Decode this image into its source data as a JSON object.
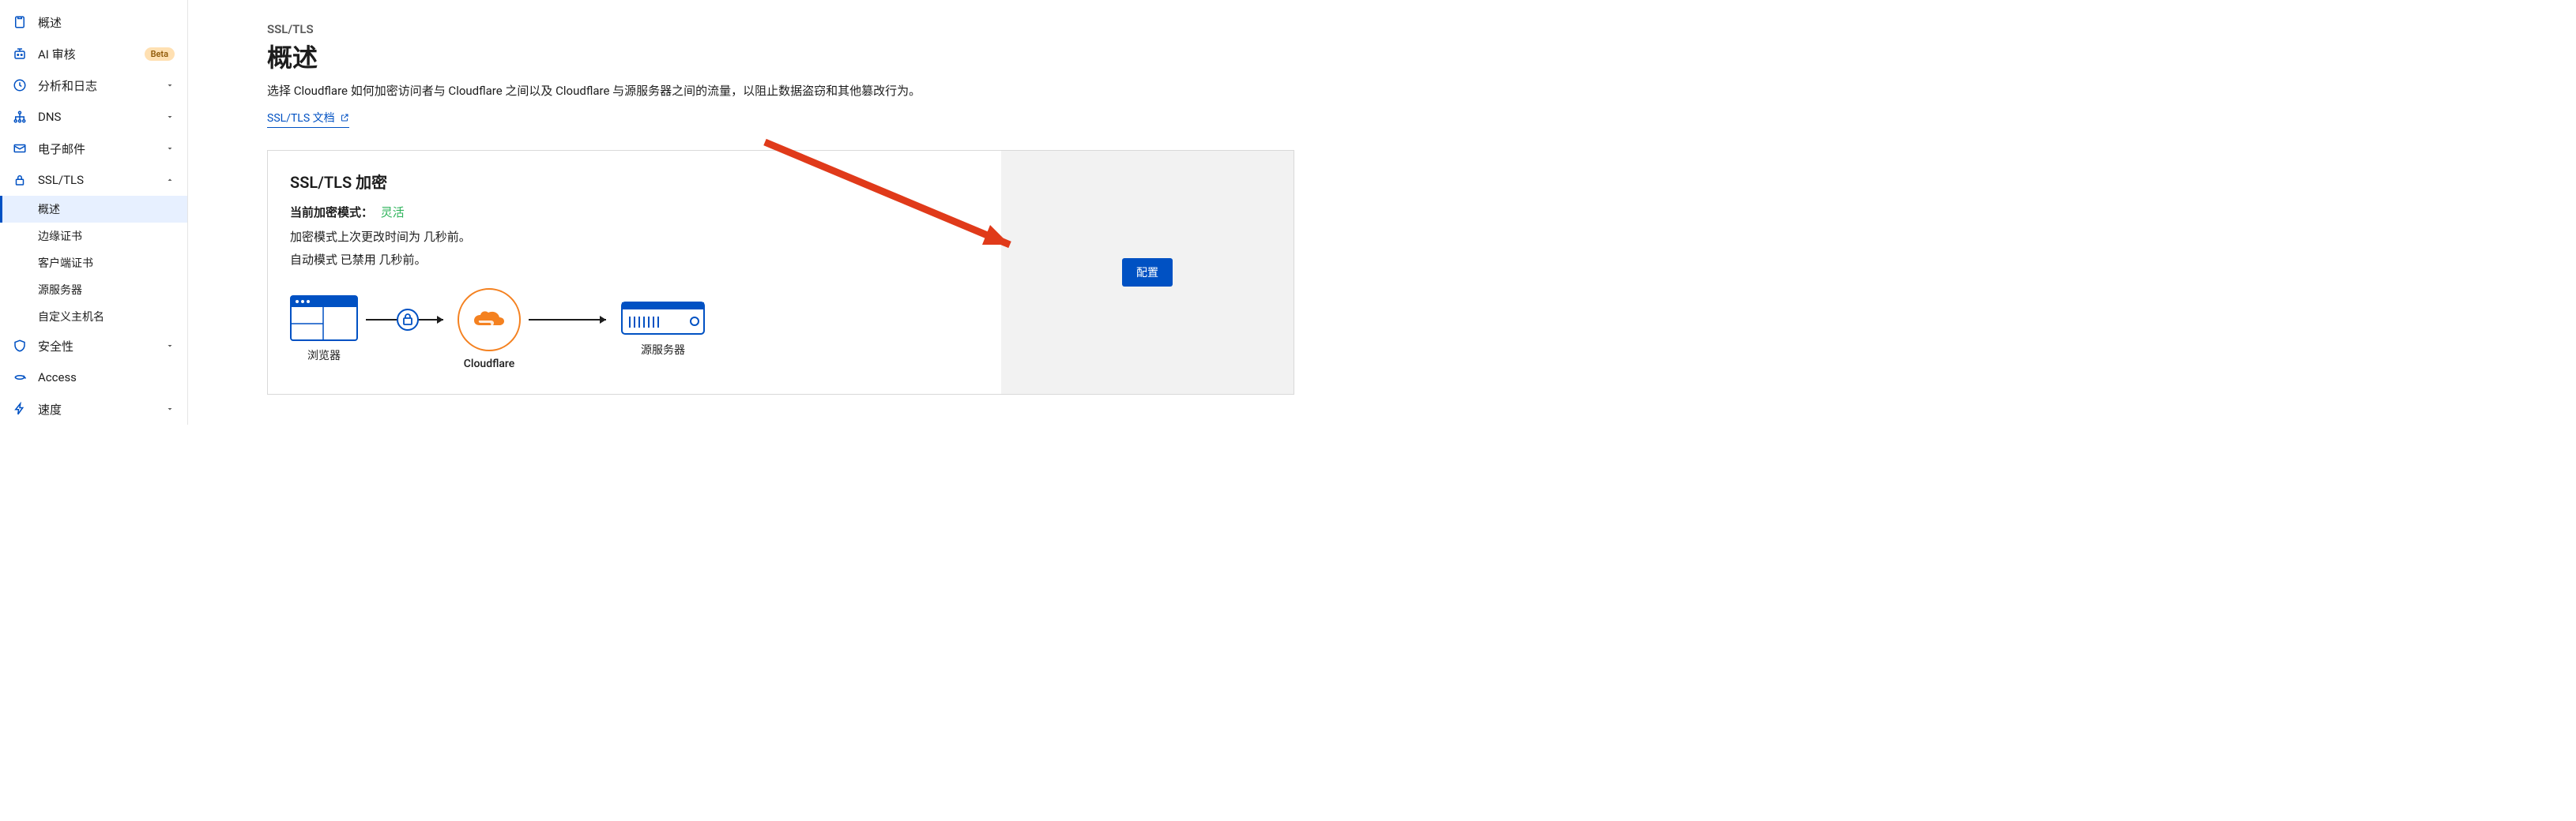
{
  "sidebar": {
    "items": [
      {
        "label": "概述",
        "expandable": false
      },
      {
        "label": "AI 审核",
        "expandable": false,
        "badge": "Beta"
      },
      {
        "label": "分析和日志",
        "expandable": true
      },
      {
        "label": "DNS",
        "expandable": true
      },
      {
        "label": "电子邮件",
        "expandable": true
      },
      {
        "label": "SSL/TLS",
        "expandable": true,
        "expanded": true
      },
      {
        "label": "安全性",
        "expandable": true
      },
      {
        "label": "Access",
        "expandable": false
      },
      {
        "label": "速度",
        "expandable": true
      }
    ],
    "ssl_sub": [
      {
        "label": "概述",
        "active": true
      },
      {
        "label": "边缘证书"
      },
      {
        "label": "客户端证书"
      },
      {
        "label": "源服务器"
      },
      {
        "label": "自定义主机名"
      }
    ]
  },
  "page": {
    "breadcrumb": "SSL/TLS",
    "title": "概述",
    "description": "选择 Cloudflare 如何加密访问者与 Cloudflare 之间以及 Cloudflare 与源服务器之间的流量，以阻止数据盗窃和其他篡改行为。",
    "doc_link": "SSL/TLS 文档"
  },
  "card": {
    "title": "SSL/TLS 加密",
    "mode_label": "当前加密模式：",
    "mode_value": "灵活",
    "line1": "加密模式上次更改时间为 几秒前。",
    "line2": "自动模式 已禁用 几秒前。",
    "diagram": {
      "browser": "浏览器",
      "cloudflare": "Cloudflare",
      "origin": "源服务器"
    },
    "configure_btn": "配置"
  }
}
